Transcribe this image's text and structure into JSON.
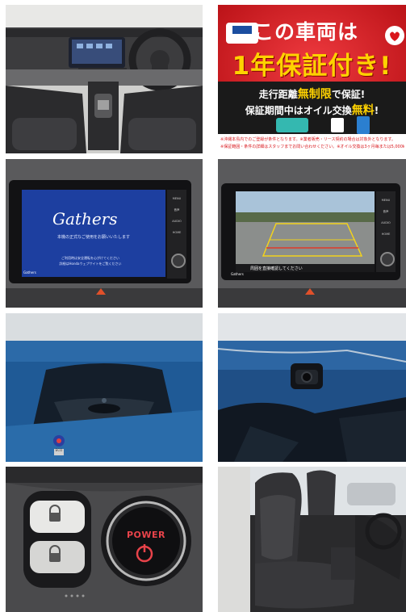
{
  "warranty_banner": {
    "line1": "この車両は",
    "line2": "1年保証付き!",
    "line3_prefix": "走行距離",
    "line3_highlight": "無制限",
    "line3_suffix": "で保証!",
    "line4_prefix": "保証期間中はオイル交換",
    "line4_highlight": "無料",
    "line4_suffix": "!",
    "fine_print1": "※沖縄本島内でのご登録が条件となります。※業者販売・リース契約の場合は対象外となります。",
    "fine_print2": "※保証範囲・条件の詳細はスタッフまでお問い合わせください。※オイル交換は3ヶ月毎または5,000km毎",
    "colors": {
      "red": "#d9171c",
      "yellow": "#ffd200",
      "dark": "#1a1a1a"
    }
  },
  "nav_screen": {
    "logo": "Gathers",
    "welcome_text": "本機の正式なご使用をお願いいたします",
    "body_text1": "ご利用時は安全運転を心がけてください",
    "body_text2": "詳細はHondaウェブサイトをご覧ください",
    "brand_small": "Gathers",
    "button_labels": [
      "MENU",
      "音声",
      "AUDIO",
      "HOME"
    ]
  },
  "rear_camera": {
    "caption": "周囲を直接確認してください",
    "brand_small": "Gathers",
    "button_labels": [
      "MENU",
      "音声",
      "AUDIO",
      "HOME"
    ]
  },
  "power_button": {
    "label": "POWER"
  },
  "sticker_text": "ECO"
}
